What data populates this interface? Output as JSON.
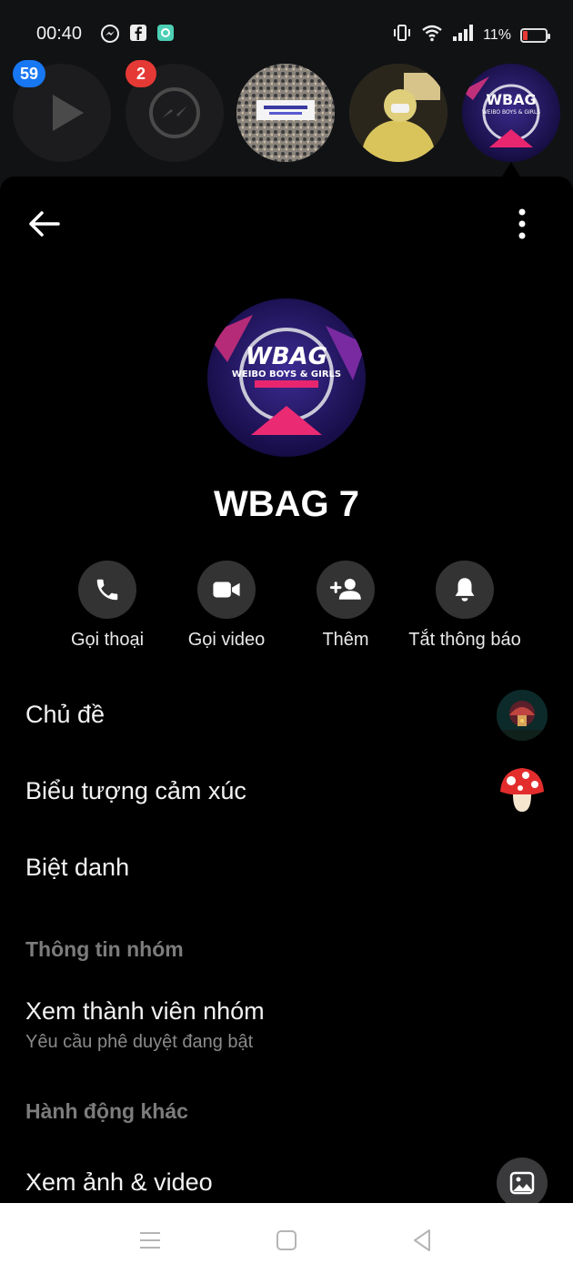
{
  "status_bar": {
    "time": "00:40",
    "battery_text": "11%",
    "icons": [
      "messenger-icon",
      "facebook-icon",
      "app-icon",
      "vibrate-icon",
      "wifi-icon",
      "signal-icon",
      "battery-icon"
    ]
  },
  "chat_heads": [
    {
      "icon": "video-play-icon",
      "badge": "59",
      "badge_color": "#1877f2"
    },
    {
      "icon": "messenger-icon",
      "badge": "2",
      "badge_color": "#e53935"
    },
    {
      "icon": "group-photo",
      "badge": null
    },
    {
      "icon": "person-photo",
      "badge": null
    },
    {
      "icon": "wbag-logo",
      "badge": null
    }
  ],
  "header": {
    "back_icon": "back-arrow-icon",
    "more_icon": "more-vertical-icon"
  },
  "group": {
    "name": "WBAG 7",
    "avatar_icon": "wbag-logo"
  },
  "actions": [
    {
      "label": "Gọi thoại",
      "icon": "phone-icon"
    },
    {
      "label": "Gọi video",
      "icon": "video-camera-icon"
    },
    {
      "label": "Thêm",
      "icon": "add-person-icon"
    },
    {
      "label": "Tắt thông báo",
      "icon": "bell-icon"
    }
  ],
  "menu": {
    "theme_label": "Chủ đề",
    "emoji_label": "Biểu tượng cảm xúc",
    "emoji_value": "🍄",
    "nickname_label": "Biệt danh",
    "group_info_title": "Thông tin nhóm",
    "members_label": "Xem thành viên nhóm",
    "members_sub": "Yêu cầu phê duyệt đang bật",
    "other_actions_title": "Hành động khác",
    "media_label": "Xem ảnh & video"
  },
  "colors": {
    "accent_blue": "#1877f2",
    "badge_red": "#e53935",
    "button_gray": "#333333",
    "section_gray": "#7c7c7c"
  }
}
